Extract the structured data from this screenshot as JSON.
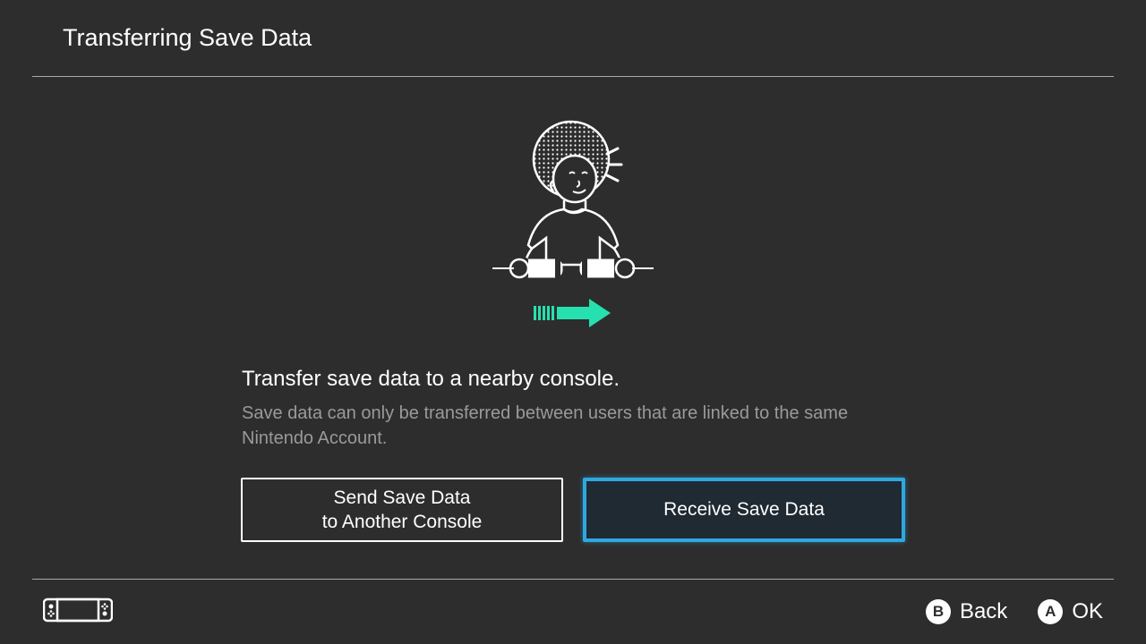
{
  "header": {
    "title": "Transferring Save Data"
  },
  "body": {
    "main_text": "Transfer save data to a nearby console.",
    "sub_text": "Save data can only be transferred between users that are linked to the same Nintendo Account."
  },
  "buttons": {
    "send": "Send Save Data\nto Another Console",
    "receive": "Receive Save Data"
  },
  "footer": {
    "back_key": "B",
    "back_label": "Back",
    "ok_key": "A",
    "ok_label": "OK"
  },
  "colors": {
    "accent": "#27e0b0",
    "highlight": "#2fa8e0"
  }
}
